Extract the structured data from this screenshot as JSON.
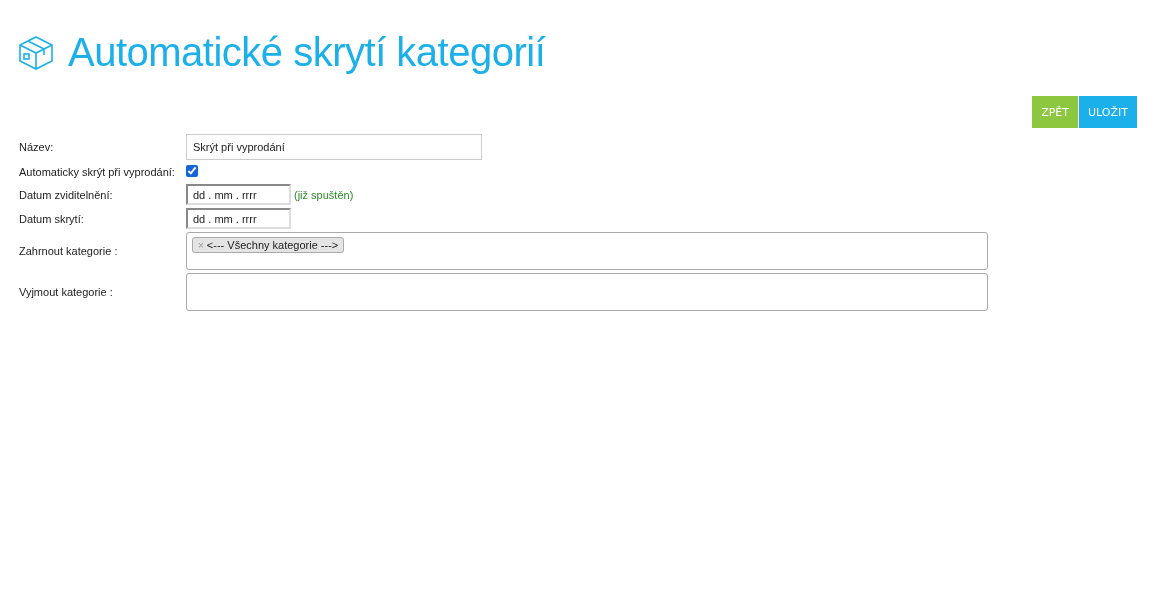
{
  "page": {
    "title": "Automatické skrytí kategorií"
  },
  "buttons": [
    {
      "label": "ZPĚT",
      "kind": "back"
    },
    {
      "label": "ULOŽIT",
      "kind": "save"
    }
  ],
  "fields": [
    {
      "kind": "text",
      "label": "Název:",
      "value": "Skrýt při vyprodání"
    },
    {
      "kind": "checkbox",
      "label": "Automaticky skrýt při vyprodání:",
      "checked": true
    },
    {
      "kind": "date",
      "label": "Datum zviditelnění:",
      "placeholder": "dd . mm . rrrr",
      "note": "(již spuštěn)"
    },
    {
      "kind": "date",
      "label": "Datum skrytí:",
      "placeholder": "dd . mm . rrrr"
    },
    {
      "kind": "multiselect",
      "label": "Zahrnout kategorie :",
      "tags": [
        {
          "remove": "×",
          "label": "<--- Všechny kategorie --->"
        }
      ]
    },
    {
      "kind": "multiselect",
      "label": "Vyjmout kategorie :"
    }
  ]
}
